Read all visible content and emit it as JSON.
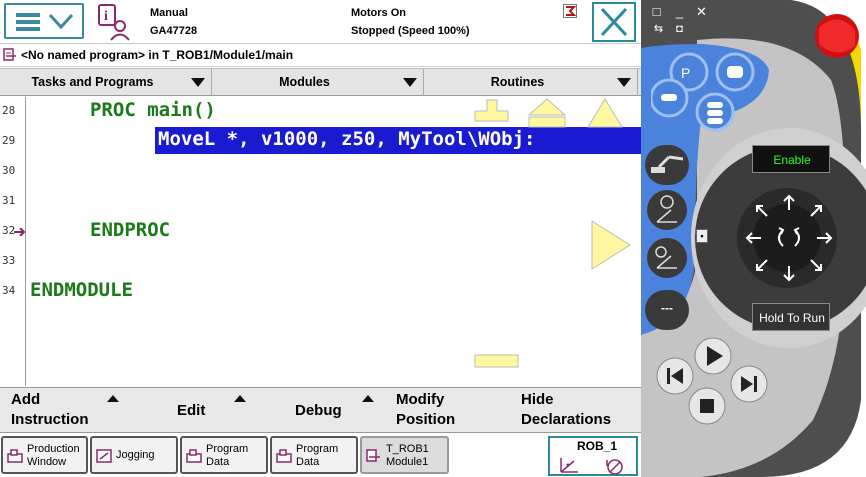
{
  "status": {
    "mode": "Manual",
    "controller": "GA47728",
    "motors": "Motors On",
    "state": "Stopped (Speed 100%)"
  },
  "path": "<No named program> in T_ROB1/Module1/main",
  "tabs": [
    {
      "label": "Tasks and Programs"
    },
    {
      "label": "Modules"
    },
    {
      "label": "Routines"
    }
  ],
  "editor": {
    "lines": [
      "28",
      "29",
      "30",
      "31",
      "32",
      "33",
      "34"
    ],
    "code_proc": "PROC main()",
    "code_move": "MoveL *, v1000, z50, MyTool\\WObj:",
    "code_endproc": "ENDPROC",
    "code_endmodule": "ENDMODULE"
  },
  "commands": {
    "add_1": "Add",
    "add_2": "Instruction",
    "edit": "Edit",
    "debug": "Debug",
    "modify_1": "Modify",
    "modify_2": "Position",
    "hide_1": "Hide",
    "hide_2": "Declarations"
  },
  "taskbar": {
    "production_1": "Production",
    "production_2": "Window",
    "jogging": "Jogging",
    "progdata1_1": "Program",
    "progdata1_2": "Data",
    "progdata2_1": "Program",
    "progdata2_2": "Data",
    "trob_1": "T_ROB1",
    "trob_2": "Module1",
    "rob": "ROB_1"
  },
  "flexpendant": {
    "enable": "Enable",
    "hold_to_run": "Hold To Run",
    "dash_label": "---",
    "icons": [
      "fullscreen-icon",
      "minimize-icon",
      "close-icon",
      "run-icon",
      "camera-icon"
    ]
  },
  "colors": {
    "accent": "#2a8a9a",
    "code_green": "#1a7a1a",
    "selection": "#1a1ad0",
    "pendant_blue": "#4a82dc",
    "pendant_yellow": "#f5d800",
    "stop_red": "#d01010",
    "enable_green": "#20ff20"
  }
}
